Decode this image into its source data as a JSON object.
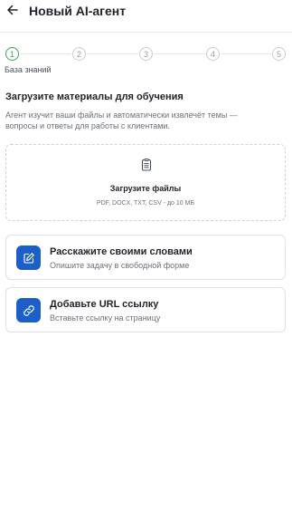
{
  "header": {
    "title": "Новый AI-агент",
    "back_icon": "arrow-left-icon"
  },
  "stepper": {
    "steps": [
      "1",
      "2",
      "3",
      "4",
      "5"
    ],
    "active_step": 1,
    "active_caption": "База знаний",
    "colors": {
      "active": "#3aa35b",
      "inactive": "#c9ccd1"
    }
  },
  "main": {
    "title": "Загрузите материалы для обучения",
    "description": "Агент изучит ваши файлы и автоматически извлечёт темы — вопросы и ответы для работы с клиентами.",
    "upload": {
      "icon": "document-icon",
      "title": "Загрузите файлы",
      "hint": "PDF, DOCX, TXT, CSV - до 10 МБ"
    },
    "options": [
      {
        "icon": "edit-icon",
        "title": "Расскажите своими словами",
        "subtitle": "Опишите задачу в свободной форме"
      },
      {
        "icon": "link-icon",
        "title": "Добавьте URL ссылку",
        "subtitle": "Вставьте ссылку на страницу"
      }
    ],
    "accent_color": "#1d5fc9"
  }
}
